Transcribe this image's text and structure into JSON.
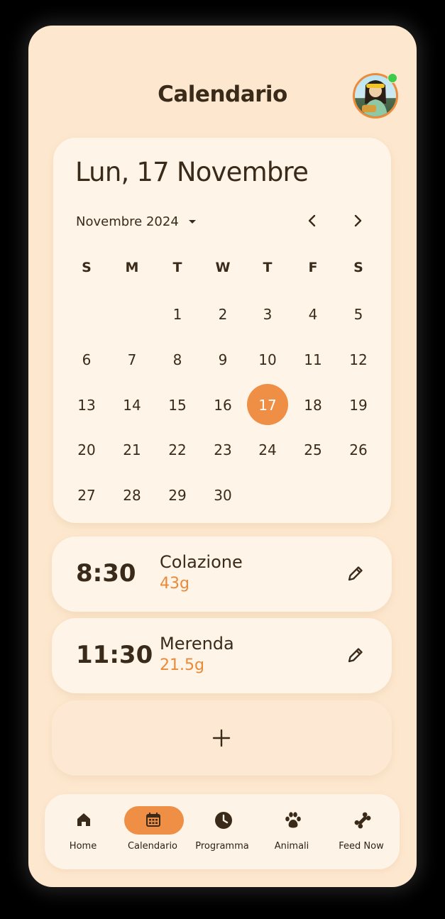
{
  "header": {
    "title": "Calendario"
  },
  "calendar": {
    "selected_date_label": "Lun, 17 Novembre",
    "month_label": "Novembre 2024",
    "weekdays": [
      "S",
      "M",
      "T",
      "W",
      "T",
      "F",
      "S"
    ],
    "weeks": [
      [
        "",
        "",
        "1",
        "2",
        "3",
        "4",
        "5"
      ],
      [
        "6",
        "7",
        "8",
        "9",
        "10",
        "11",
        "12"
      ],
      [
        "13",
        "14",
        "15",
        "16",
        "17",
        "18",
        "19"
      ],
      [
        "20",
        "21",
        "22",
        "23",
        "24",
        "25",
        "26"
      ],
      [
        "27",
        "28",
        "29",
        "30",
        "",
        "",
        ""
      ]
    ],
    "selected_day": "17"
  },
  "meals": [
    {
      "time": "8:30",
      "name": "Colazione",
      "quantity": "43g"
    },
    {
      "time": "11:30",
      "name": "Merenda",
      "quantity": "21.5g"
    }
  ],
  "nav": {
    "items": [
      {
        "label": "Home",
        "icon": "home-icon"
      },
      {
        "label": "Calendario",
        "icon": "calendar-icon"
      },
      {
        "label": "Programma",
        "icon": "clock-icon"
      },
      {
        "label": "Animali",
        "icon": "paw-icon"
      },
      {
        "label": "Feed Now",
        "icon": "bone-icon"
      }
    ],
    "active": "Calendario"
  },
  "colors": {
    "background": "#fde8cf",
    "card": "#fef4e8",
    "accent": "#ef8f45",
    "text": "#3a2a1a",
    "online": "#3ccb4b"
  }
}
